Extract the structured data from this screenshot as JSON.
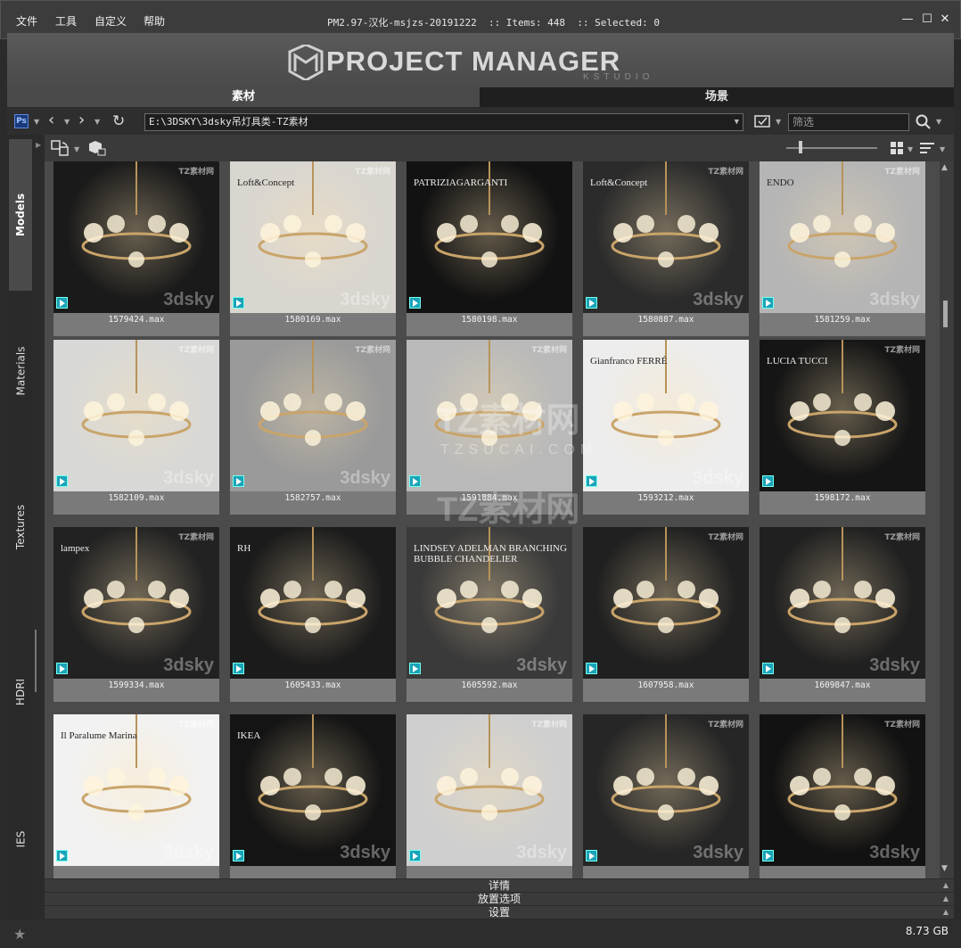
{
  "menu": [
    "文件",
    "工具",
    "自定义",
    "帮助"
  ],
  "title": {
    "text": "PM2.97-汉化-msjzs-20191222  :: Items: 448  :: Selected: 0"
  },
  "banner": {
    "logo_text": "PROJECT MANAGER",
    "logo_sub": "KSTUDIO"
  },
  "tabs": [
    "素材",
    "场景"
  ],
  "toolbar": {
    "ps_label": "Ps",
    "path": "E:\\3DSKY\\3dsky吊灯具类-TZ素材",
    "filter_placeholder": "筛选"
  },
  "side_tabs": [
    "Models",
    "Materials",
    "Textures",
    "HDRI",
    "IES"
  ],
  "icons": {
    "back": "chevron-left-icon",
    "forward": "chevron-right-icon",
    "refresh": "refresh-icon",
    "search": "search-icon",
    "grid_view": "grid-view-icon",
    "sort": "sort-icon",
    "star": "star-icon"
  },
  "items": [
    {
      "file": "1579424.max",
      "bg": "#1a1a1a",
      "brand": "",
      "watermark": "3dsky",
      "logo": "TZ素材网"
    },
    {
      "file": "1580169.max",
      "bg": "#d9d6d0",
      "brand": "Loft&Concept",
      "watermark": "3dsky",
      "logo": "TZ素材网"
    },
    {
      "file": "1580198.max",
      "bg": "#121212",
      "brand": "PATRIZIAGARGANTI",
      "watermark": "",
      "logo": ""
    },
    {
      "file": "1580887.max",
      "bg": "#2b2b2b",
      "brand": "Loft&Concept",
      "watermark": "3dsky",
      "logo": "TZ素材网"
    },
    {
      "file": "1581259.max",
      "bg": "#b5b5b5",
      "brand": "ENDO",
      "watermark": "3dsky",
      "logo": "TZ素材网"
    },
    {
      "file": "1582109.max",
      "bg": "#d8d8d6",
      "brand": "",
      "watermark": "3dsky",
      "logo": "TZ素材网"
    },
    {
      "file": "1582757.max",
      "bg": "#9a9a9a",
      "brand": "",
      "watermark": "3dsky",
      "logo": "TZ素材网"
    },
    {
      "file": "1591884.max",
      "bg": "#b9b9b9",
      "brand": "",
      "watermark": "",
      "logo": "TZ素材网"
    },
    {
      "file": "1593212.max",
      "bg": "#ededed",
      "brand": "Gianfranco FERRÉ",
      "watermark": "3dsky",
      "logo": ""
    },
    {
      "file": "1598172.max",
      "bg": "#151515",
      "brand": "LUCIA TUCCI",
      "watermark": "",
      "logo": "TZ素材网"
    },
    {
      "file": "1599334.max",
      "bg": "#222222",
      "brand": "lampex",
      "watermark": "3dsky",
      "logo": "TZ素材网"
    },
    {
      "file": "1605433.max",
      "bg": "#1b1b1b",
      "brand": "RH",
      "watermark": "",
      "logo": ""
    },
    {
      "file": "1605592.max",
      "bg": "#3a3a3a",
      "brand": "LINDSEY ADELMAN BRANCHING BUBBLE CHANDELIER",
      "watermark": "3dsky",
      "logo": ""
    },
    {
      "file": "1607958.max",
      "bg": "#202020",
      "brand": "",
      "watermark": "",
      "logo": "TZ素材网"
    },
    {
      "file": "1609847.max",
      "bg": "#202020",
      "brand": "",
      "watermark": "3dsky",
      "logo": "TZ素材网"
    },
    {
      "file": "",
      "bg": "#f2f2f2",
      "brand": "Il Paralume Marina",
      "watermark": "3dsky",
      "logo": "TZ素材网"
    },
    {
      "file": "",
      "bg": "#141414",
      "brand": "IKEA",
      "watermark": "3dsky",
      "logo": ""
    },
    {
      "file": "",
      "bg": "#cfcfcf",
      "brand": "",
      "watermark": "3dsky",
      "logo": "TZ素材网"
    },
    {
      "file": "",
      "bg": "#262626",
      "brand": "",
      "watermark": "3dsky",
      "logo": "TZ素材网"
    },
    {
      "file": "",
      "bg": "#121212",
      "brand": "",
      "watermark": "3dsky",
      "logo": "TZ素材网"
    }
  ],
  "bottom_panels": [
    "详情",
    "放置选项",
    "设置"
  ],
  "status": {
    "disk_size": "8.73 GB"
  },
  "overlay_watermark": {
    "line1": "TZ素材网",
    "line2": "TZSUCAI.COM",
    "line3": "TZ素材网"
  }
}
